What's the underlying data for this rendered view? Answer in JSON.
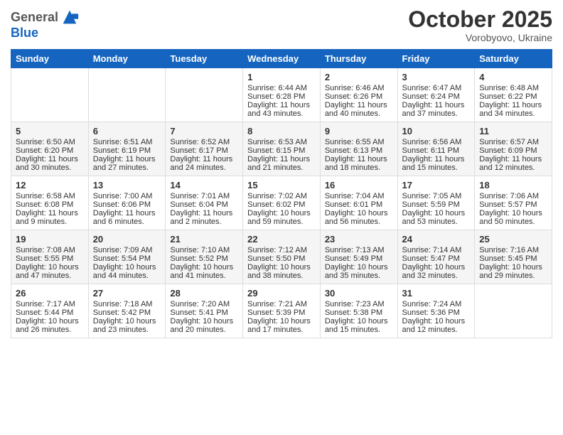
{
  "header": {
    "logo_line1": "General",
    "logo_line2": "Blue",
    "month": "October 2025",
    "location": "Vorobyovo, Ukraine"
  },
  "weekdays": [
    "Sunday",
    "Monday",
    "Tuesday",
    "Wednesday",
    "Thursday",
    "Friday",
    "Saturday"
  ],
  "weeks": [
    [
      {
        "day": "",
        "sunrise": "",
        "sunset": "",
        "daylight": ""
      },
      {
        "day": "",
        "sunrise": "",
        "sunset": "",
        "daylight": ""
      },
      {
        "day": "",
        "sunrise": "",
        "sunset": "",
        "daylight": ""
      },
      {
        "day": "1",
        "sunrise": "Sunrise: 6:44 AM",
        "sunset": "Sunset: 6:28 PM",
        "daylight": "Daylight: 11 hours and 43 minutes."
      },
      {
        "day": "2",
        "sunrise": "Sunrise: 6:46 AM",
        "sunset": "Sunset: 6:26 PM",
        "daylight": "Daylight: 11 hours and 40 minutes."
      },
      {
        "day": "3",
        "sunrise": "Sunrise: 6:47 AM",
        "sunset": "Sunset: 6:24 PM",
        "daylight": "Daylight: 11 hours and 37 minutes."
      },
      {
        "day": "4",
        "sunrise": "Sunrise: 6:48 AM",
        "sunset": "Sunset: 6:22 PM",
        "daylight": "Daylight: 11 hours and 34 minutes."
      }
    ],
    [
      {
        "day": "5",
        "sunrise": "Sunrise: 6:50 AM",
        "sunset": "Sunset: 6:20 PM",
        "daylight": "Daylight: 11 hours and 30 minutes."
      },
      {
        "day": "6",
        "sunrise": "Sunrise: 6:51 AM",
        "sunset": "Sunset: 6:19 PM",
        "daylight": "Daylight: 11 hours and 27 minutes."
      },
      {
        "day": "7",
        "sunrise": "Sunrise: 6:52 AM",
        "sunset": "Sunset: 6:17 PM",
        "daylight": "Daylight: 11 hours and 24 minutes."
      },
      {
        "day": "8",
        "sunrise": "Sunrise: 6:53 AM",
        "sunset": "Sunset: 6:15 PM",
        "daylight": "Daylight: 11 hours and 21 minutes."
      },
      {
        "day": "9",
        "sunrise": "Sunrise: 6:55 AM",
        "sunset": "Sunset: 6:13 PM",
        "daylight": "Daylight: 11 hours and 18 minutes."
      },
      {
        "day": "10",
        "sunrise": "Sunrise: 6:56 AM",
        "sunset": "Sunset: 6:11 PM",
        "daylight": "Daylight: 11 hours and 15 minutes."
      },
      {
        "day": "11",
        "sunrise": "Sunrise: 6:57 AM",
        "sunset": "Sunset: 6:09 PM",
        "daylight": "Daylight: 11 hours and 12 minutes."
      }
    ],
    [
      {
        "day": "12",
        "sunrise": "Sunrise: 6:58 AM",
        "sunset": "Sunset: 6:08 PM",
        "daylight": "Daylight: 11 hours and 9 minutes."
      },
      {
        "day": "13",
        "sunrise": "Sunrise: 7:00 AM",
        "sunset": "Sunset: 6:06 PM",
        "daylight": "Daylight: 11 hours and 6 minutes."
      },
      {
        "day": "14",
        "sunrise": "Sunrise: 7:01 AM",
        "sunset": "Sunset: 6:04 PM",
        "daylight": "Daylight: 11 hours and 2 minutes."
      },
      {
        "day": "15",
        "sunrise": "Sunrise: 7:02 AM",
        "sunset": "Sunset: 6:02 PM",
        "daylight": "Daylight: 10 hours and 59 minutes."
      },
      {
        "day": "16",
        "sunrise": "Sunrise: 7:04 AM",
        "sunset": "Sunset: 6:01 PM",
        "daylight": "Daylight: 10 hours and 56 minutes."
      },
      {
        "day": "17",
        "sunrise": "Sunrise: 7:05 AM",
        "sunset": "Sunset: 5:59 PM",
        "daylight": "Daylight: 10 hours and 53 minutes."
      },
      {
        "day": "18",
        "sunrise": "Sunrise: 7:06 AM",
        "sunset": "Sunset: 5:57 PM",
        "daylight": "Daylight: 10 hours and 50 minutes."
      }
    ],
    [
      {
        "day": "19",
        "sunrise": "Sunrise: 7:08 AM",
        "sunset": "Sunset: 5:55 PM",
        "daylight": "Daylight: 10 hours and 47 minutes."
      },
      {
        "day": "20",
        "sunrise": "Sunrise: 7:09 AM",
        "sunset": "Sunset: 5:54 PM",
        "daylight": "Daylight: 10 hours and 44 minutes."
      },
      {
        "day": "21",
        "sunrise": "Sunrise: 7:10 AM",
        "sunset": "Sunset: 5:52 PM",
        "daylight": "Daylight: 10 hours and 41 minutes."
      },
      {
        "day": "22",
        "sunrise": "Sunrise: 7:12 AM",
        "sunset": "Sunset: 5:50 PM",
        "daylight": "Daylight: 10 hours and 38 minutes."
      },
      {
        "day": "23",
        "sunrise": "Sunrise: 7:13 AM",
        "sunset": "Sunset: 5:49 PM",
        "daylight": "Daylight: 10 hours and 35 minutes."
      },
      {
        "day": "24",
        "sunrise": "Sunrise: 7:14 AM",
        "sunset": "Sunset: 5:47 PM",
        "daylight": "Daylight: 10 hours and 32 minutes."
      },
      {
        "day": "25",
        "sunrise": "Sunrise: 7:16 AM",
        "sunset": "Sunset: 5:45 PM",
        "daylight": "Daylight: 10 hours and 29 minutes."
      }
    ],
    [
      {
        "day": "26",
        "sunrise": "Sunrise: 7:17 AM",
        "sunset": "Sunset: 5:44 PM",
        "daylight": "Daylight: 10 hours and 26 minutes."
      },
      {
        "day": "27",
        "sunrise": "Sunrise: 7:18 AM",
        "sunset": "Sunset: 5:42 PM",
        "daylight": "Daylight: 10 hours and 23 minutes."
      },
      {
        "day": "28",
        "sunrise": "Sunrise: 7:20 AM",
        "sunset": "Sunset: 5:41 PM",
        "daylight": "Daylight: 10 hours and 20 minutes."
      },
      {
        "day": "29",
        "sunrise": "Sunrise: 7:21 AM",
        "sunset": "Sunset: 5:39 PM",
        "daylight": "Daylight: 10 hours and 17 minutes."
      },
      {
        "day": "30",
        "sunrise": "Sunrise: 7:23 AM",
        "sunset": "Sunset: 5:38 PM",
        "daylight": "Daylight: 10 hours and 15 minutes."
      },
      {
        "day": "31",
        "sunrise": "Sunrise: 7:24 AM",
        "sunset": "Sunset: 5:36 PM",
        "daylight": "Daylight: 10 hours and 12 minutes."
      },
      {
        "day": "",
        "sunrise": "",
        "sunset": "",
        "daylight": ""
      }
    ]
  ]
}
